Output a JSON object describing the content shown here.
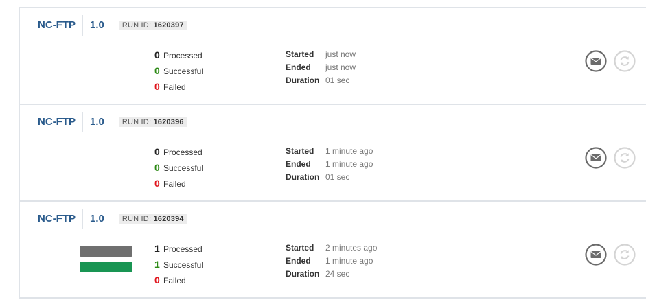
{
  "runs": [
    {
      "job_name": "NC-FTP",
      "version": "1.0",
      "run_id_label": "RUN ID:",
      "run_id": "1620397",
      "processed": {
        "count": "0",
        "label": "Processed"
      },
      "successful": {
        "count": "0",
        "label": "Successful"
      },
      "failed": {
        "count": "0",
        "label": "Failed"
      },
      "started": {
        "label": "Started",
        "value": "just now"
      },
      "ended": {
        "label": "Ended",
        "value": "just now"
      },
      "duration": {
        "label": "Duration",
        "value": "01 sec"
      },
      "show_bars": false
    },
    {
      "job_name": "NC-FTP",
      "version": "1.0",
      "run_id_label": "RUN ID:",
      "run_id": "1620396",
      "processed": {
        "count": "0",
        "label": "Processed"
      },
      "successful": {
        "count": "0",
        "label": "Successful"
      },
      "failed": {
        "count": "0",
        "label": "Failed"
      },
      "started": {
        "label": "Started",
        "value": "1 minute ago"
      },
      "ended": {
        "label": "Ended",
        "value": "1 minute ago"
      },
      "duration": {
        "label": "Duration",
        "value": "01 sec"
      },
      "show_bars": false
    },
    {
      "job_name": "NC-FTP",
      "version": "1.0",
      "run_id_label": "RUN ID:",
      "run_id": "1620394",
      "processed": {
        "count": "1",
        "label": "Processed"
      },
      "successful": {
        "count": "1",
        "label": "Successful"
      },
      "failed": {
        "count": "0",
        "label": "Failed"
      },
      "started": {
        "label": "Started",
        "value": "2 minutes ago"
      },
      "ended": {
        "label": "Ended",
        "value": "1 minute ago"
      },
      "duration": {
        "label": "Duration",
        "value": "24 sec"
      },
      "show_bars": true
    }
  ],
  "icons": {
    "email": "envelope-icon",
    "rerun": "refresh-icon"
  },
  "colors": {
    "job_title": "#2a5b8c",
    "successful": "#2d8a16",
    "failed": "#e0141c",
    "bar_processed": "#6f6f6f",
    "bar_successful": "#199553",
    "icon_active": "#6b6b6b",
    "icon_disabled": "#cfcfcf"
  }
}
